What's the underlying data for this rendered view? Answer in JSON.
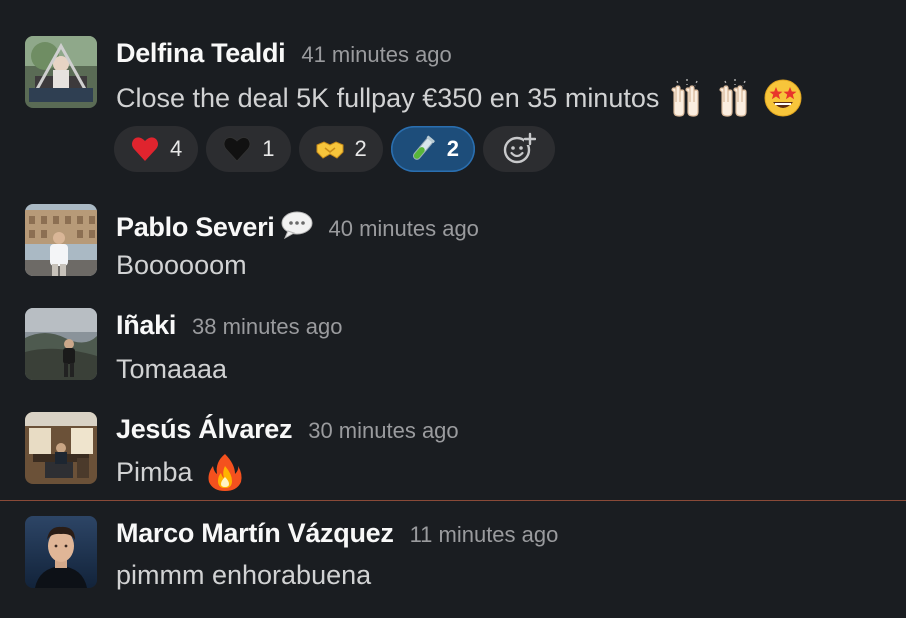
{
  "messages": [
    {
      "author": "Delfina Tealdi",
      "time": "41 minutes ago",
      "text": "Close the deal 5K fullpay €350 en 35 minutos",
      "reactions": [
        {
          "emoji": "heart-icon",
          "count": "4",
          "active": false
        },
        {
          "emoji": "black-heart-icon",
          "count": "1",
          "active": false
        },
        {
          "emoji": "handshake-icon",
          "count": "2",
          "active": false
        },
        {
          "emoji": "test-tube-icon",
          "count": "2",
          "active": true
        }
      ]
    },
    {
      "author": "Pablo Severi",
      "time": "40 minutes ago",
      "text": "Boooooom"
    },
    {
      "author": "Iñaki",
      "time": "38 minutes ago",
      "text": "Tomaaaa"
    },
    {
      "author": "Jesús Álvarez",
      "time": "30 minutes ago",
      "text": "Pimba"
    },
    {
      "author": "Marco Martín Vázquez",
      "time": "11 minutes ago",
      "text": "pimmm enhorabuena"
    }
  ],
  "colors": {
    "background": "#1a1d21",
    "reaction_bg": "#2c2d30",
    "reaction_active_bg": "#1d4d7a",
    "new_messages_divider": "#8a4a38"
  }
}
